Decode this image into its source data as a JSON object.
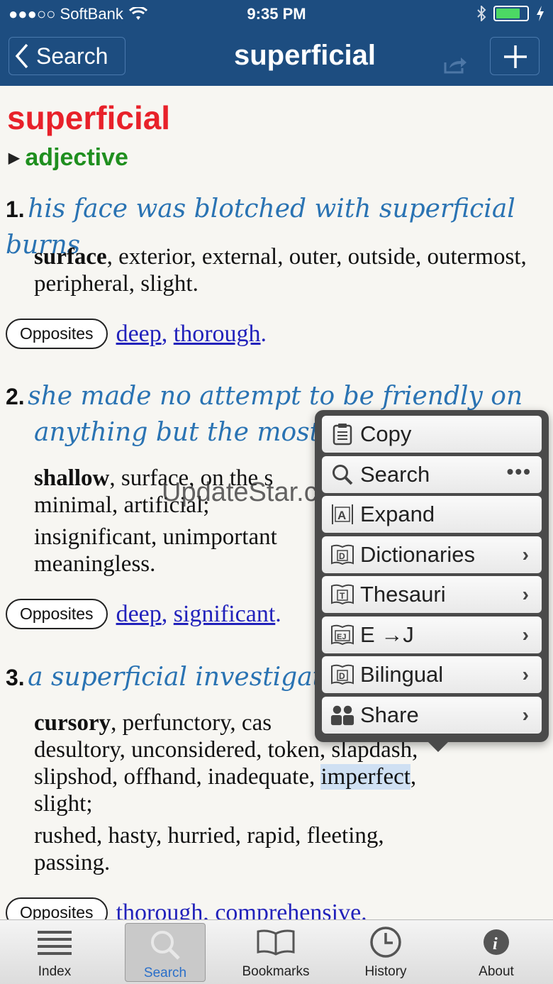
{
  "status_bar": {
    "carrier": "●●●○○ SoftBank",
    "time": "9:35 PM"
  },
  "nav": {
    "back_label": "Search",
    "title": "superficial"
  },
  "entry": {
    "headword": "superficial",
    "part_of_speech": "adjective",
    "senses": [
      {
        "number": "1.",
        "example": "his face was blotched with superficial burns",
        "synonym_lead": "surface",
        "synonyms": ", exterior, external, outer, outside, outermost, peripheral, slight.",
        "opposites_label": "Opposites",
        "opposites": [
          "deep",
          "thorough"
        ]
      },
      {
        "number": "2.",
        "example_line1": "she made no attempt to be friendly on",
        "example_line2": "anything but the most sup",
        "synonym_lead": "shallow",
        "synonyms_line1": ", surface, on the s",
        "synonyms_line2": "minimal, artificial;",
        "synonyms_line3": "insignificant, unimportant",
        "synonyms_line4": "meaningless.",
        "opposites_label": "Opposites",
        "opposites": [
          "deep",
          "significant"
        ]
      },
      {
        "number": "3.",
        "example": "a superficial investigation",
        "synonym_lead": "cursory",
        "synonyms_line1": ", perfunctory, cas",
        "synonyms_line2": "desultory, unconsidered, token, slapdash,",
        "synonyms_line3a": "slipshod, offhand, inadequate, ",
        "synonyms_highlight": "imperfect",
        "synonyms_line3b": ",",
        "synonyms_line4": "slight;",
        "synonyms_line5": "rushed, hasty, hurried, rapid, fleeting,",
        "synonyms_line6": "passing.",
        "opposites_label": "Opposites",
        "opposites": [
          "thorough",
          "comprehensive"
        ]
      }
    ]
  },
  "watermark": "UpdateStar.com",
  "popup_menu": {
    "items": [
      {
        "label": "Copy",
        "icon": "clipboard-icon"
      },
      {
        "label": "Search",
        "icon": "magnifier-icon",
        "more": "•••"
      },
      {
        "label": "Expand",
        "icon": "expand-icon"
      },
      {
        "label": "Dictionaries",
        "icon": "dictionary-book-icon"
      },
      {
        "label": "Thesauri",
        "icon": "thesaurus-book-icon"
      },
      {
        "label": "E →J",
        "icon": "ej-book-icon"
      },
      {
        "label": "Bilingual",
        "icon": "bilingual-book-icon"
      },
      {
        "label": "Share",
        "icon": "people-icon"
      }
    ]
  },
  "tab_bar": {
    "tabs": [
      {
        "label": "Index",
        "icon": "list-icon"
      },
      {
        "label": "Search",
        "icon": "search-icon",
        "active": true
      },
      {
        "label": "Bookmarks",
        "icon": "open-book-icon"
      },
      {
        "label": "History",
        "icon": "clock-icon"
      },
      {
        "label": "About",
        "icon": "info-icon"
      }
    ]
  },
  "colors": {
    "nav_bg": "#1d4d80",
    "headword": "#e8212a",
    "part_of_speech": "#1f8f1f",
    "example": "#2a73b3",
    "link": "#2222bb",
    "active_tab": "#2a6fc9"
  }
}
